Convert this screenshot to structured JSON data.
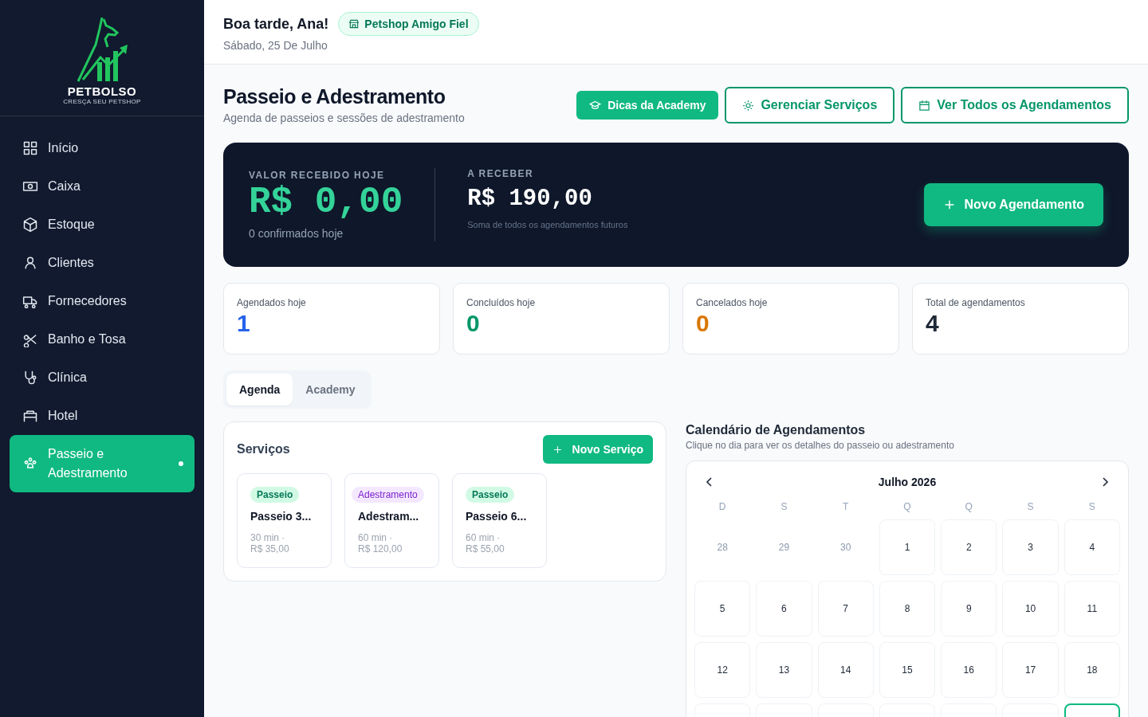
{
  "sidebar": {
    "logo": {
      "name": "PETBOLSO",
      "tagline": "CRESÇA SEU PETSHOP"
    },
    "items": [
      {
        "label": "Início",
        "selected": false
      },
      {
        "label": "Caixa",
        "selected": false
      },
      {
        "label": "Estoque",
        "selected": false
      },
      {
        "label": "Clientes",
        "selected": false
      },
      {
        "label": "Fornecedores",
        "selected": false
      },
      {
        "label": "Banho e Tosa",
        "selected": false
      },
      {
        "label": "Clínica",
        "selected": false
      },
      {
        "label": "Hotel",
        "selected": false
      },
      {
        "label": "Passeio e Adestramento",
        "selected": true
      }
    ]
  },
  "header": {
    "greeting": "Boa tarde, Ana!",
    "store": "Petshop Amigo Fiel",
    "date": "Sábado, 25 De Julho"
  },
  "page": {
    "title": "Passeio e Adestramento",
    "subtitle": "Agenda de passeios e sessões de adestramento",
    "actions": [
      {
        "label": "Dicas da Academy",
        "kind": "filled"
      },
      {
        "label": "Gerenciar Serviços",
        "kind": "outline"
      },
      {
        "label": "Ver Todos os Agendamentos",
        "kind": "outline"
      }
    ]
  },
  "summary": {
    "received": {
      "label": "VALOR RECEBIDO HOJE",
      "value": "R$ 0,00",
      "note": "0 confirmados hoje"
    },
    "pending": {
      "label": "A RECEBER",
      "value": "R$ 190,00",
      "note": "Soma de todos os agendamentos futuros"
    },
    "action": "Novo Agendamento"
  },
  "stats": [
    {
      "label": "Agendados hoje",
      "value": "1",
      "color": "#2563eb"
    },
    {
      "label": "Concluídos hoje",
      "value": "0",
      "color": "#059669"
    },
    {
      "label": "Cancelados hoje",
      "value": "0",
      "color": "#d97706"
    },
    {
      "label": "Total de agendamentos",
      "value": "4",
      "color": "#1f2937"
    }
  ],
  "tabs": [
    {
      "label": "Agenda",
      "selected": true
    },
    {
      "label": "Academy",
      "selected": false
    }
  ],
  "services": {
    "title": "Serviços",
    "action": "Novo Serviço",
    "items": [
      {
        "tag": "Passeio",
        "kind": "passeio",
        "name": "Passeio 3...",
        "duration": "30 min ·",
        "price": "R$ 35,00"
      },
      {
        "tag": "Adestramento",
        "kind": "adestramento",
        "name": "Adestram...",
        "duration": "60 min ·",
        "price": "R$ 120,00"
      },
      {
        "tag": "Passeio",
        "kind": "passeio",
        "name": "Passeio 6...",
        "duration": "60 min ·",
        "price": "R$ 55,00"
      }
    ]
  },
  "calendar": {
    "title": "Calendário de Agendamentos",
    "subtitle": "Clique no dia para ver os detalhes do passeio ou adestramento",
    "month": "Julho 2026",
    "weekdays": [
      "D",
      "S",
      "T",
      "Q",
      "Q",
      "S",
      "S"
    ],
    "days": [
      {
        "label": "28",
        "outside": true
      },
      {
        "label": "29",
        "outside": true
      },
      {
        "label": "30",
        "outside": true
      },
      {
        "label": "1",
        "outside": false
      },
      {
        "label": "2",
        "outside": false
      },
      {
        "label": "3",
        "outside": false
      },
      {
        "label": "4",
        "outside": false
      },
      {
        "label": "5",
        "outside": false
      },
      {
        "label": "6",
        "outside": false
      },
      {
        "label": "7",
        "outside": false
      },
      {
        "label": "8",
        "outside": false
      },
      {
        "label": "9",
        "outside": false
      },
      {
        "label": "10",
        "outside": false
      },
      {
        "label": "11",
        "outside": false
      },
      {
        "label": "12",
        "outside": false
      },
      {
        "label": "13",
        "outside": false
      },
      {
        "label": "14",
        "outside": false
      },
      {
        "label": "15",
        "outside": false
      },
      {
        "label": "16",
        "outside": false
      },
      {
        "label": "17",
        "outside": false
      },
      {
        "label": "18",
        "outside": false
      }
    ],
    "next_row": [
      {
        "selected": false
      },
      {
        "selected": false
      },
      {
        "selected": false
      },
      {
        "selected": false
      },
      {
        "selected": false
      },
      {
        "selected": false
      },
      {
        "selected": true
      }
    ]
  }
}
